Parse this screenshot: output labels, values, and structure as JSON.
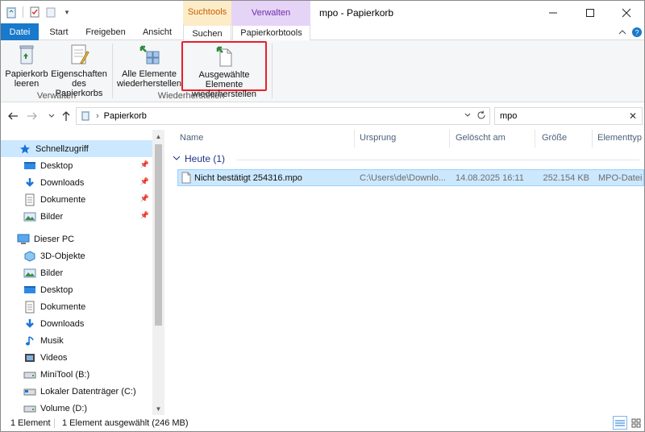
{
  "window": {
    "title": "mpo - Papierkorb"
  },
  "context_tabs": {
    "suchtools": "Suchtools",
    "verwalten": "Verwalten"
  },
  "tabs": [
    {
      "label": "Datei"
    },
    {
      "label": "Start"
    },
    {
      "label": "Freigeben"
    },
    {
      "label": "Ansicht"
    },
    {
      "label": "Suchen"
    },
    {
      "label": "Papierkorbtools"
    }
  ],
  "ribbon": {
    "buttons": [
      {
        "line1": "Papierkorb",
        "line2": "leeren"
      },
      {
        "line1": "Eigenschaften",
        "line2": "des Papierkorbs"
      },
      {
        "line1": "Alle Elemente",
        "line2": "wiederherstellen"
      },
      {
        "line1": "Ausgewählte Elemente",
        "line2": "wiederherstellen"
      }
    ],
    "groups": [
      {
        "label": "Verwalten"
      },
      {
        "label": "Wiederherstellen"
      }
    ]
  },
  "address": {
    "path": "Papierkorb",
    "separator": "›"
  },
  "search": {
    "value": "mpo"
  },
  "nav": {
    "quick_access": "Schnellzugriff",
    "quick_items": [
      {
        "label": "Desktop"
      },
      {
        "label": "Downloads"
      },
      {
        "label": "Dokumente"
      },
      {
        "label": "Bilder"
      }
    ],
    "this_pc": "Dieser PC",
    "pc_items": [
      {
        "label": "3D-Objekte"
      },
      {
        "label": "Bilder"
      },
      {
        "label": "Desktop"
      },
      {
        "label": "Dokumente"
      },
      {
        "label": "Downloads"
      },
      {
        "label": "Musik"
      },
      {
        "label": "Videos"
      },
      {
        "label": "MiniTool (B:)"
      },
      {
        "label": "Lokaler Datenträger (C:)"
      },
      {
        "label": "Volume (D:)"
      }
    ]
  },
  "columns": [
    {
      "label": "Name"
    },
    {
      "label": "Ursprung"
    },
    {
      "label": "Gelöscht am"
    },
    {
      "label": "Größe"
    },
    {
      "label": "Elementtyp"
    }
  ],
  "group": {
    "label": "Heute (1)"
  },
  "files": [
    {
      "name": "Nicht bestätigt 254316.mpo",
      "origin": "C:\\Users\\de\\Downlo...",
      "deleted": "14.08.2025 16:11",
      "size": "252.154 KB",
      "type": "MPO-Datei"
    }
  ],
  "status": {
    "count": "1 Element",
    "selection": "1 Element ausgewählt (246 MB)"
  },
  "colors": {
    "accent": "#1979ca",
    "selection": "#cce8ff",
    "highlight_border": "#e8202a",
    "suchtools_bg": "#fdecc8",
    "verwalten_bg": "#e6d4f7"
  }
}
